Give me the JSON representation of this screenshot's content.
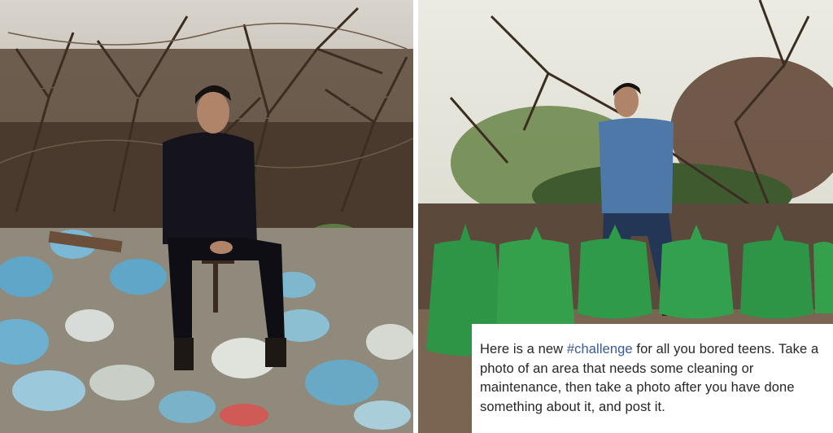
{
  "caption": {
    "prefix": "Here is a new ",
    "hashtag": "#challenge",
    "suffix": " for all you bored teens. Take a photo of an area that needs some cleaning or maintenance, then take a photo after you have done something about it, and post it."
  },
  "colors": {
    "hashtag": "#385898",
    "caption_text": "#262626",
    "trash_bags": "#2f9a48"
  }
}
